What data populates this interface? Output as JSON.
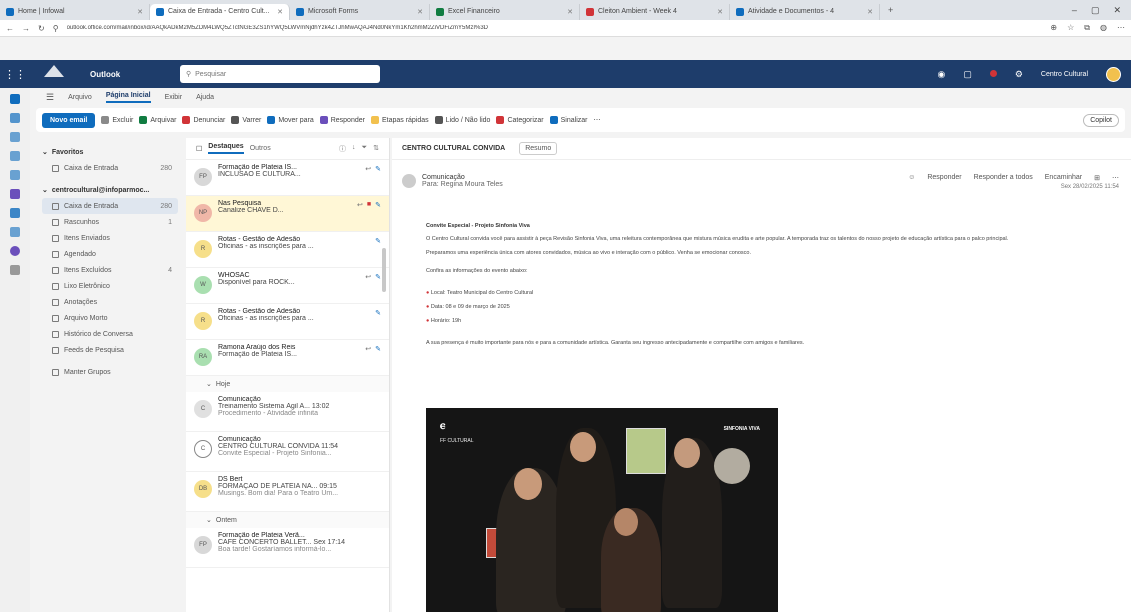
{
  "browser": {
    "tabs": [
      {
        "label": "Home | Infowal",
        "color": "#0f6cbd",
        "active": false
      },
      {
        "label": "Caixa de Entrada - Centro Cult...",
        "color": "#0f6cbd",
        "active": true
      },
      {
        "label": "Microsoft Forms",
        "color": "#0f6cbd",
        "active": false
      },
      {
        "label": "Excel Financeiro",
        "color": "#107c41",
        "active": false
      },
      {
        "label": "Cleiton Ambient - Week 4",
        "color": "#d13438",
        "active": false
      },
      {
        "label": "Atividade e Documentos - 4",
        "color": "#0f6cbd",
        "active": false
      }
    ],
    "url": "outlook.office.com/mail/inbox/id/AAQkADkM2M5ZDM4LWQ5ZTctNGE3ZS1hYWQ5LWVmNjdhYzk4ZTJhMwAQAJ4Nd0NkYm1Kh2hmM2ZiVDFiZmY5MzI%3D"
  },
  "header": {
    "app_name": "Outlook",
    "search_placeholder": "Pesquisar",
    "user_name": "Centro Cultural"
  },
  "ribbon": {
    "tabs": [
      "Arquivo",
      "Página Inicial",
      "Exibir",
      "Ajuda"
    ],
    "active_tab": "Página Inicial",
    "new_mail": "Novo email",
    "buttons": [
      {
        "label": "Excluir",
        "color": "#8a8a8a"
      },
      {
        "label": "Arquivar",
        "color": "#107c41"
      },
      {
        "label": "Denunciar",
        "color": "#d13438"
      },
      {
        "label": "Varrer",
        "color": "#555555"
      },
      {
        "label": "Mover para",
        "color": "#0f6cbd"
      },
      {
        "label": "Responder",
        "color": "#6b4fbb"
      },
      {
        "label": "Etapas rápidas",
        "color": "#f2c14e"
      },
      {
        "label": "Lido / Não lido",
        "color": "#555555"
      },
      {
        "label": "Categorizar",
        "color": "#d13438"
      },
      {
        "label": "Sinalizar",
        "color": "#0f6cbd"
      }
    ],
    "copilot": "Copilot"
  },
  "folders": {
    "favorites_title": "Favoritos",
    "favorites": [
      {
        "label": "Caixa de Entrada",
        "count": "280"
      }
    ],
    "account_title": "centrocultural@infoparmoc...",
    "items": [
      {
        "label": "Caixa de Entrada",
        "count": "280"
      },
      {
        "label": "Rascunhos",
        "count": "1"
      },
      {
        "label": "Itens Enviados",
        "count": ""
      },
      {
        "label": "Agendado",
        "count": ""
      },
      {
        "label": "Itens Excluídos",
        "count": "4"
      },
      {
        "label": "Lixo Eletrônico",
        "count": ""
      },
      {
        "label": "Anotações",
        "count": ""
      },
      {
        "label": "Arquivo Morto",
        "count": ""
      },
      {
        "label": "Histórico de Conversa",
        "count": ""
      },
      {
        "label": "Feeds de Pesquisa",
        "count": ""
      }
    ],
    "manage": "Manter Grupos"
  },
  "list": {
    "tab_focused": "Destaques",
    "tab_other": "Outros",
    "messages": [
      {
        "sender": "Formação de Plateia IS...",
        "subject": "INCLUSÃO E CULTURA...",
        "preview": "",
        "av": "FP",
        "avcolor": "#d8d8d8",
        "selected": false
      },
      {
        "sender": "Nas Pesquisa",
        "subject": "Canalize CHAVE D...",
        "preview": "",
        "av": "NP",
        "avcolor": "#f0b7a8",
        "selected": true
      },
      {
        "sender": "Rotas - Gestão de Adesão",
        "subject": "Oficinas - as inscrições para ...",
        "preview": "",
        "av": "R",
        "avcolor": "#f6df8a",
        "selected": false
      },
      {
        "sender": "WHOSAC",
        "subject": "Disponível para ROCK...",
        "preview": "",
        "av": "W",
        "avcolor": "#a9dfb0",
        "selected": false
      },
      {
        "sender": "Rotas - Gestão de Adesão",
        "subject": "Oficinas - as inscrições para ...",
        "preview": "",
        "av": "R",
        "avcolor": "#f6df8a",
        "selected": false
      },
      {
        "sender": "Ramona Araújo dos Reis",
        "subject": "Formação de Plateia IS...",
        "preview": "",
        "av": "RA",
        "avcolor": "#a9dfb0",
        "selected": false
      }
    ],
    "group_today": "Hoje",
    "today": [
      {
        "sender": "Comunicação",
        "subject": "Treinamento Sistema Ágil A... 13:02",
        "preview": "Procedimento - Atividade infinita",
        "av": "C",
        "avcolor": "#e0e0e0"
      },
      {
        "sender": "Comunicação",
        "subject": "CENTRO CULTURAL CONVIDA  11:54",
        "preview": "Convite Especial - Projeto Sinfonia...",
        "av": "C",
        "avcolor": "#ffffff"
      },
      {
        "sender": "DS Bert",
        "subject": "FORMAÇÃO DE PLATEIA NA... 09:15",
        "preview": "Musings. Bom dia! Para o Teatro Um...",
        "av": "DB",
        "avcolor": "#f6df8a"
      }
    ],
    "group_older": "Ontem",
    "older": [
      {
        "sender": "Formação de Plateia Verã...",
        "subject": "CAFÉ CONCERTO BALLET... Sex 17:14",
        "preview": "Boa tarde! Gostaríamos informá-lo...",
        "av": "FP",
        "avcolor": "#d8d8d8"
      }
    ]
  },
  "reading": {
    "subject": "CENTRO CULTURAL CONVIDA",
    "summary_btn": "Resumo",
    "sender_name": "Comunicação",
    "sender_to": "Para: Regina Moura Teles",
    "actions": [
      "Responder",
      "Responder a todos",
      "Encaminhar"
    ],
    "date": "Sex 28/02/2025 11:54",
    "body_title": "Convite Especial - Projeto Sinfonia Viva",
    "body_p1": "O Centro Cultural convida você para assistir à peça Revisão Sinfonia Viva, uma releitura contemporânea que mistura música erudita e arte popular. A temporada traz os talentos do nosso projeto de educação artística para o palco principal.",
    "body_p2": "Preparamos uma experiência única com atores convidados, música ao vivo e interação com o público. Venha se emocionar conosco.",
    "body_p3": "Confira as informações do evento abaixo:",
    "events": [
      "Local: Teatro Municipal do Centro Cultural",
      "Data: 08 e 09 de março de 2025",
      "Horário: 19h"
    ],
    "body_p4": "A sua presença é muito importante para nós e para a comunidade artística. Garanta seu ingresso antecipadamente e compartilhe com amigos e familiares.",
    "poster_logo": "FF CULTURAL",
    "poster_tag": "SINFONIA VIVA"
  }
}
